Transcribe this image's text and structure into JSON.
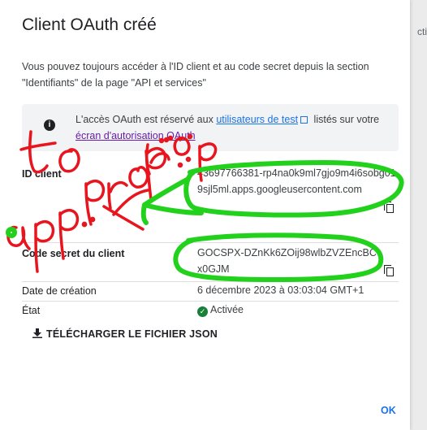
{
  "dialog": {
    "title": "Client OAuth créé",
    "description": "Vous pouvez toujours accéder à l'ID client et au code secret depuis la section \"Identifiants\" de la page \"API et services\"",
    "banner": {
      "text_before": "L'accès OAuth est réservé aux ",
      "link1": "utilisateurs de test",
      "text_middle": " listés sur votre ",
      "link2": "écran d'autorisation OAuth"
    },
    "client_id_label": "ID client",
    "client_id_value": "43697766381-rp4na0k9ml7gjo9m4i6sobg019sjl5ml.apps.googleusercontent.com",
    "secret_label": "Code secret du client",
    "secret_value": "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",
    "date_label": "Date de création",
    "date_value": "6 décembre 2023 à 03:03:04 GMT+1",
    "state_label": "État",
    "state_value": "Activée",
    "download_label": "TÉLÉCHARGER LE FICHIER JSON",
    "ok_label": "OK"
  },
  "background": {
    "edge_text": "cti"
  },
  "annotation": {
    "line1": "to",
    "line2": "app.prop..."
  },
  "colors": {
    "link": "#1a73e8",
    "visited_link": "#681da8",
    "annotation_red": "#e8141e",
    "annotation_green": "#22d11c",
    "success": "#188038"
  }
}
